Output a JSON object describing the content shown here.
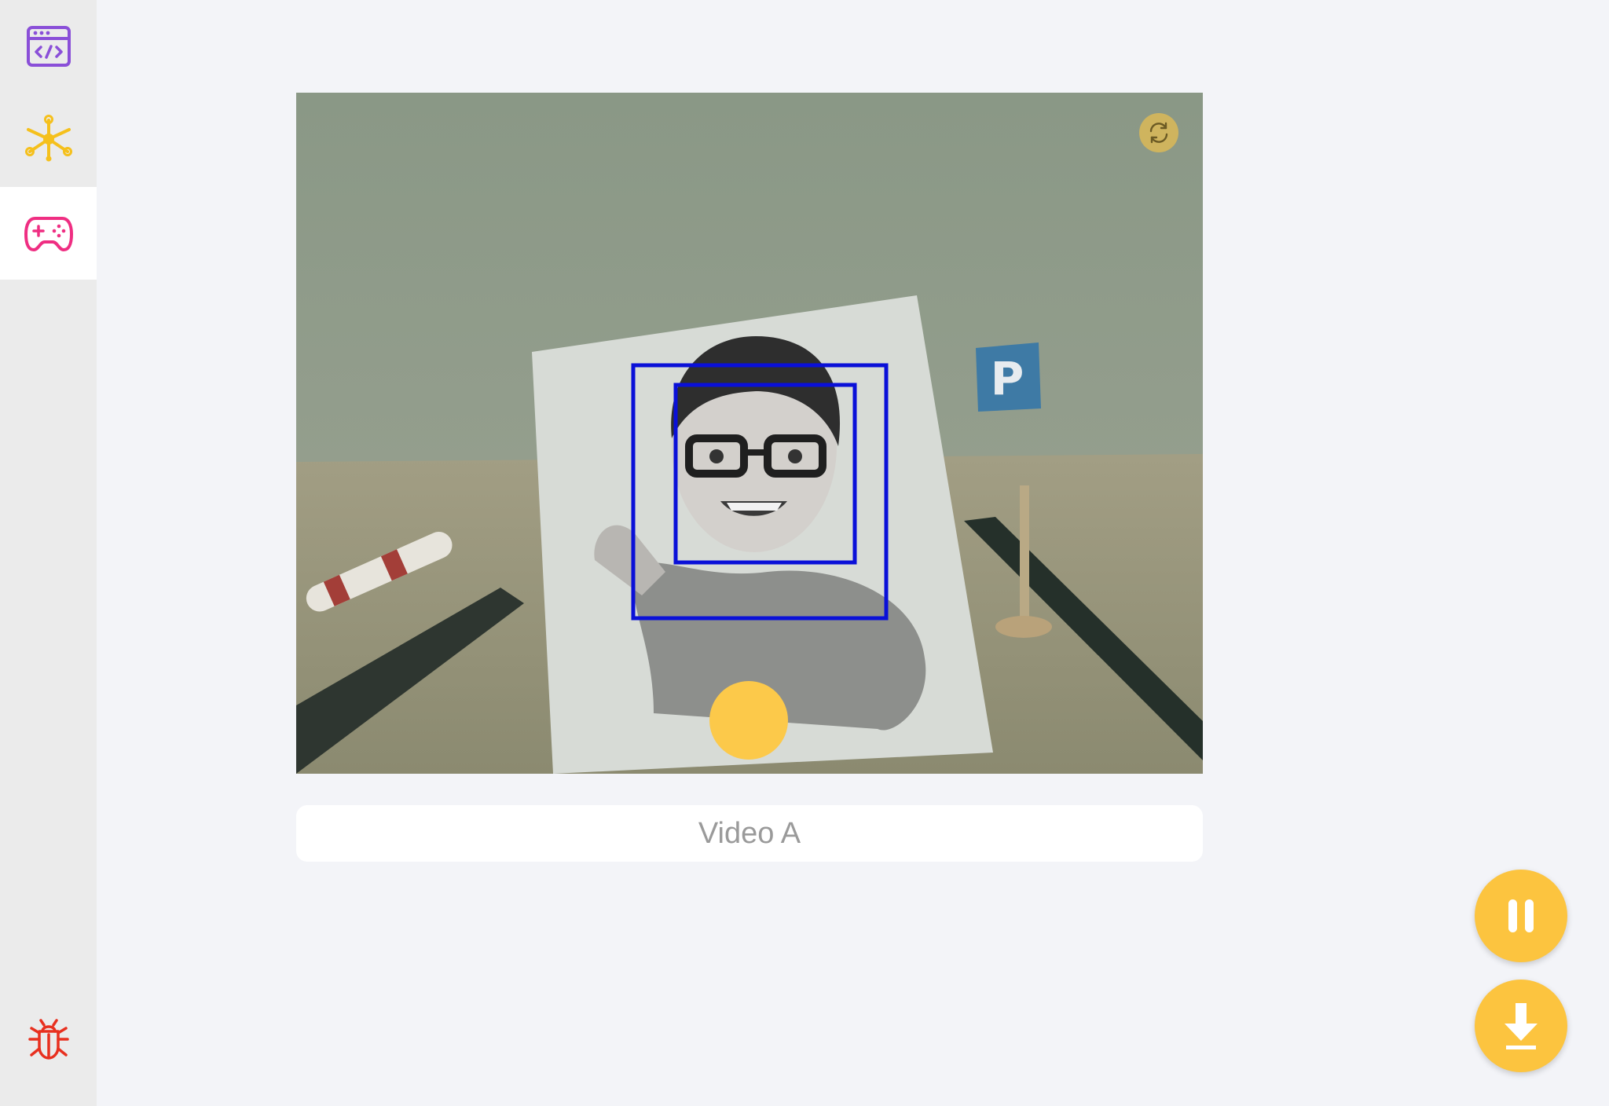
{
  "sidebar": {
    "items": [
      {
        "icon": "code-window-icon",
        "color": "#8a4fd8",
        "active": false
      },
      {
        "icon": "network-nodes-icon",
        "color": "#f5c01c",
        "active": false
      },
      {
        "icon": "gamepad-icon",
        "color": "#ef2e82",
        "active": true
      },
      {
        "icon": "bug-icon",
        "color": "#e8301f",
        "active": false
      }
    ]
  },
  "video": {
    "caption": "Video A",
    "sign_letter": "P",
    "box_color": "#0a10d8",
    "controls": {
      "switch_camera_icon": "switch-camera-icon",
      "capture_icon": "capture-button"
    }
  },
  "actions": {
    "pause_icon": "pause-icon",
    "download_icon": "download-icon",
    "accent": "#fcc43f"
  }
}
